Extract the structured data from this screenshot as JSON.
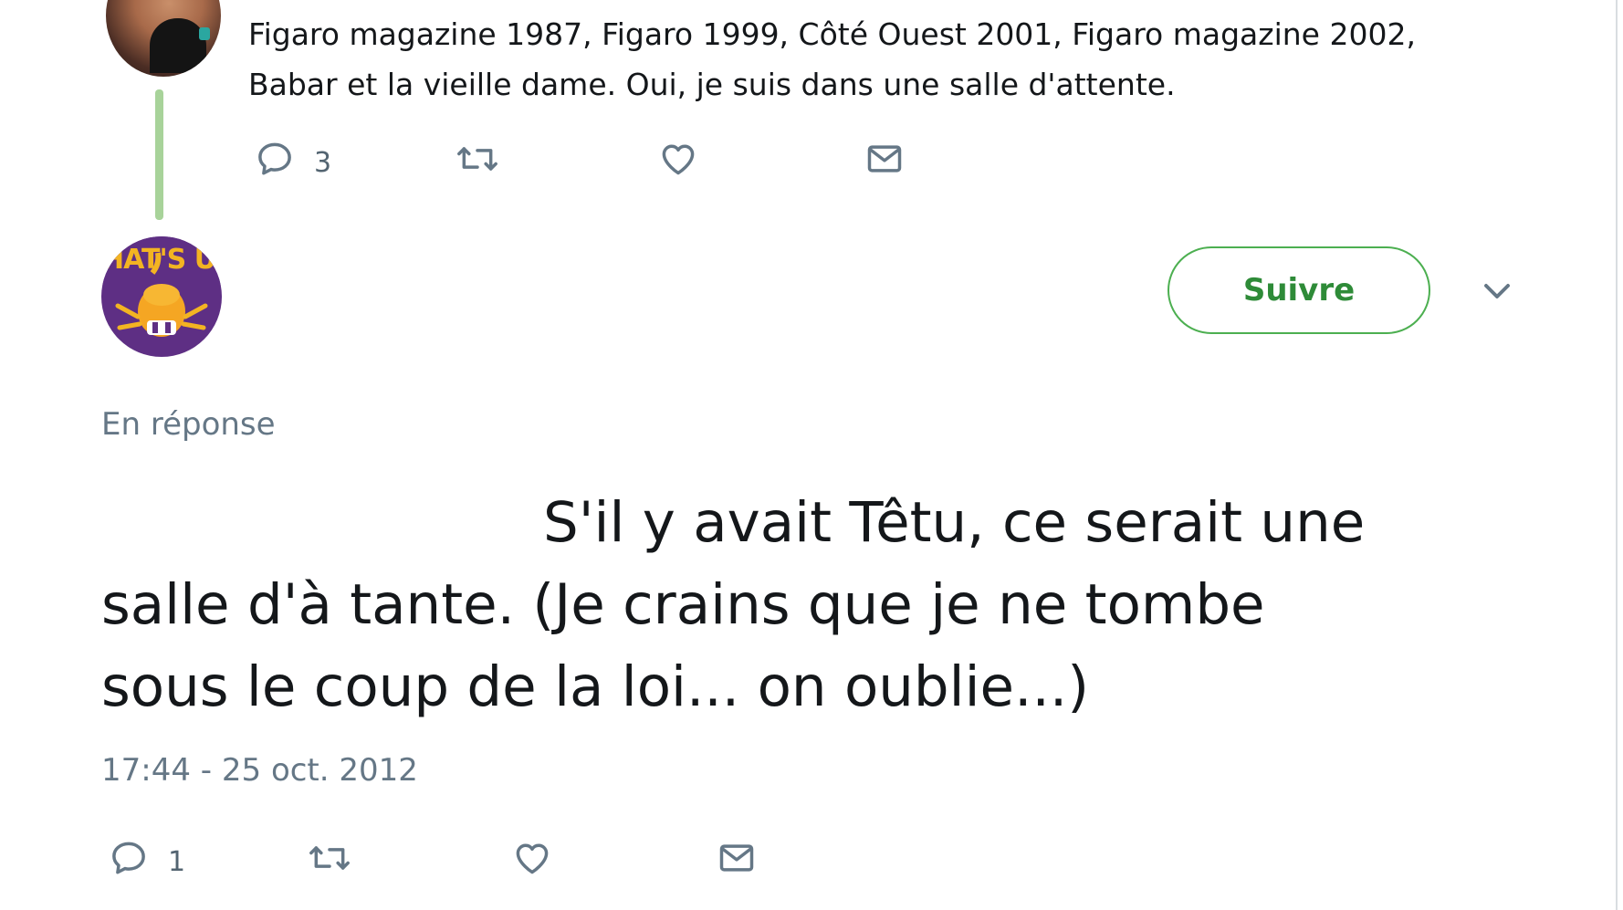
{
  "parent_tweet": {
    "text_lines": [
      "Figaro magazine 1987, Figaro 1999, Côté Ouest 2001, Figaro magazine 2002,",
      "Babar et la vieille dame. Oui, je suis dans une salle d'attente."
    ],
    "actions": {
      "reply_count": "3",
      "retweet_count": "",
      "like_count": ""
    }
  },
  "reply_tweet": {
    "avatar_text": "HAT'S UP",
    "follow_label": "Suivre",
    "replying_to": "En réponse",
    "text_lines": [
      "S'il y avait Têtu, ce serait une",
      "salle d'à tante. (Je crains que je ne tombe",
      "sous le coup de la loi... on oublie...)"
    ],
    "timestamp": "17:44 - 25 oct. 2012",
    "actions": {
      "reply_count": "1",
      "retweet_count": "",
      "like_count": ""
    }
  },
  "colors": {
    "follow_accent": "#4caf50",
    "thread_line": "#a8d39a",
    "muted_text": "#657786",
    "icon": "#657786"
  },
  "icons": {
    "reply": "speech-bubble-icon",
    "retweet": "retweet-icon",
    "like": "heart-icon",
    "dm": "envelope-icon",
    "more": "chevron-down-icon"
  }
}
